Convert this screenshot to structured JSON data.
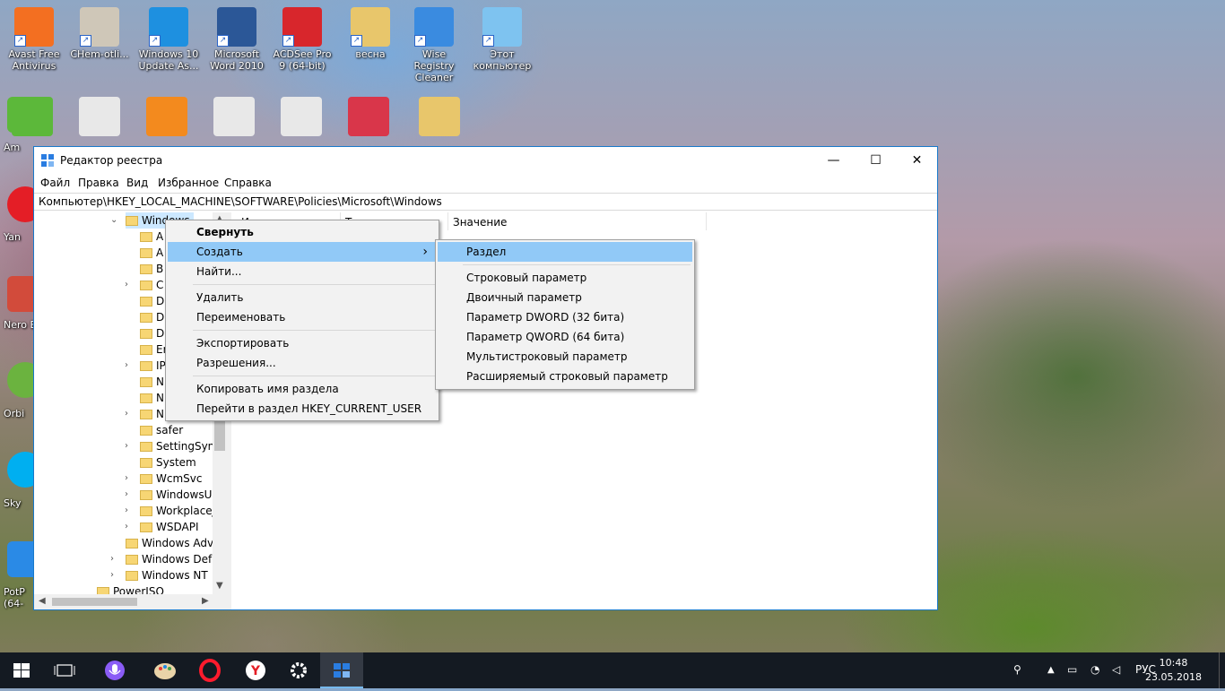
{
  "desktop": {
    "icons_top": [
      {
        "label": "Avast Free\nAntivirus",
        "name": "avast-icon",
        "color": "#f36f21"
      },
      {
        "label": "CHem-otli...",
        "name": "image-file-icon",
        "color": "#cfc7b8"
      },
      {
        "label": "Windows 10\nUpdate As...",
        "name": "windows-update-icon",
        "color": "#1e90e0"
      },
      {
        "label": "Microsoft\nWord 2010",
        "name": "word-icon",
        "color": "#2b5797"
      },
      {
        "label": "ACDSee Pro\n9 (64-bit)",
        "name": "acdsee-icon",
        "color": "#d8262c"
      },
      {
        "label": "весна",
        "name": "folder-icon",
        "color": "#e8c66b"
      },
      {
        "label": "Wise Registry\nCleaner",
        "name": "wise-registry-icon",
        "color": "#3a8be0"
      },
      {
        "label": "Этот\nкомпьютер",
        "name": "this-pc-icon",
        "color": "#7ec3f0"
      }
    ],
    "icons_row2_colors": [
      "#5cb83a",
      "#e8e8e8",
      "#f38a1e",
      "#e8e8e8",
      "#e8e8e8",
      "#d9364a",
      "#e8c66b"
    ],
    "side_labels": [
      "Am",
      "Yan",
      "Nero E",
      "Orbi",
      "Sky",
      "PotP\n(64-"
    ]
  },
  "window": {
    "title": "Редактор реестра",
    "controls": {
      "minimize": "—",
      "maximize": "☐",
      "close": "✕"
    },
    "menu": [
      "Файл",
      "Правка",
      "Вид",
      "Избранное",
      "Справка"
    ],
    "address": "Компьютер\\HKEY_LOCAL_MACHINE\\SOFTWARE\\Policies\\Microsoft\\Windows",
    "tree": {
      "selected": "Windows",
      "children_partial": [
        "A",
        "A",
        "B",
        "C",
        "D",
        "D",
        "D",
        "Er",
        "IP",
        "N",
        "N",
        "N"
      ],
      "children_full": [
        "safer",
        "SettingSync",
        "System",
        "WcmSvc",
        "WindowsUp",
        "WorkplaceJ",
        "WSDAPI"
      ],
      "siblings": [
        "Windows Adva",
        "Windows Defe",
        "Windows NT"
      ],
      "bottom": "PowerISO"
    },
    "columns": {
      "col1": "И",
      "col2": "Т",
      "value": "Значение"
    }
  },
  "context_menu": {
    "items": [
      "Свернуть",
      "Создать",
      "Найти...",
      "Удалить",
      "Переименовать",
      "Экспортировать",
      "Разрешения...",
      "Копировать имя раздела",
      "Перейти в раздел HKEY_CURRENT_USER"
    ],
    "submenu_arrow": "›"
  },
  "submenu": {
    "items": [
      "Раздел",
      "Строковый параметр",
      "Двоичный параметр",
      "Параметр DWORD (32 бита)",
      "Параметр QWORD (64 бита)",
      "Мультистроковый параметр",
      "Расширяемый строковый параметр"
    ]
  },
  "taskbar": {
    "apps": [
      "start-icon",
      "task-view-icon",
      "cortana-icon",
      "paint-icon",
      "opera-icon",
      "yandex-icon",
      "settings-icon",
      "regedit-icon"
    ],
    "language": "РУС",
    "time": "10:48",
    "date": "23.05.2018"
  }
}
